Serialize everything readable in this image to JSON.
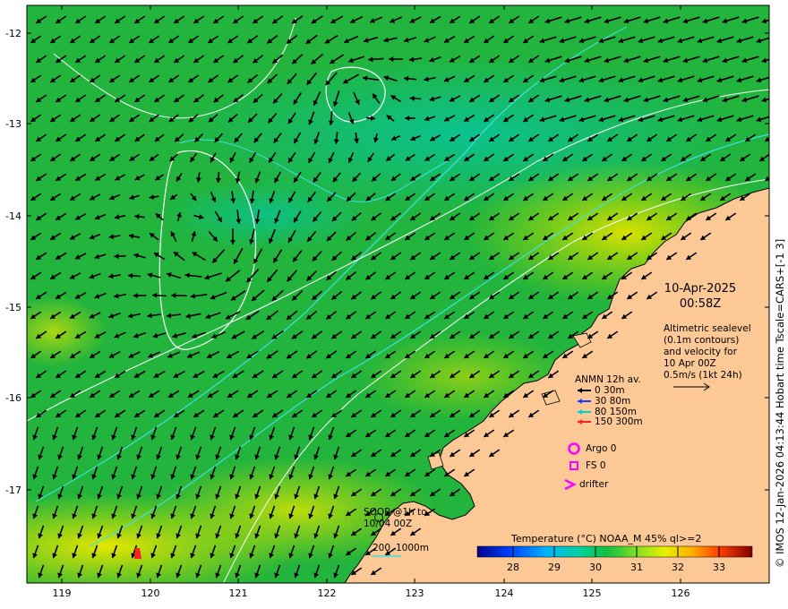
{
  "map": {
    "lat_ticks": [
      "-12",
      "-13",
      "-14",
      "-15",
      "-16",
      "-17"
    ],
    "lon_ticks": [
      "119",
      "120",
      "121",
      "122",
      "123",
      "124",
      "125",
      "126"
    ],
    "date": "10-Apr-2025",
    "time": "00:58Z",
    "info_lines": [
      "Altimetric sealevel",
      "(0.1m contours)",
      "and velocity for",
      "10 Apr 00Z",
      "0.5m/s (1kt 24h)"
    ],
    "anmn": {
      "title": "ANMN 12h av.",
      "rows": [
        {
          "label": "0 30m",
          "color": "#000000"
        },
        {
          "label": "30 80m",
          "color": "#1e3cff"
        },
        {
          "label": "80 150m",
          "color": "#00d2d2"
        },
        {
          "label": "150 300m",
          "color": "#ff2020"
        }
      ]
    },
    "markers": {
      "argo": "Argo 0",
      "fs": "FS 0",
      "drifter": "drifter",
      "color": "#ff00ff"
    },
    "soop": [
      "SOOP @1h to",
      "10/04 00Z"
    ],
    "depth_contours": {
      "shallow": "200",
      "deep": "1000m",
      "color": "#40e0e0"
    },
    "colorbar": {
      "title": "Temperature (°C) NOAA_M 45% ql>=2",
      "labels": [
        "28",
        "29",
        "30",
        "31",
        "32",
        "33"
      ]
    },
    "credit": "© IMOS 12-Jan-2026 04:13:44 Hobart time Tscale=CARS+[-1 3]",
    "colors": {
      "land": "#fcc896",
      "sea_mid": "#20b840",
      "contour": "#ffffff"
    }
  }
}
